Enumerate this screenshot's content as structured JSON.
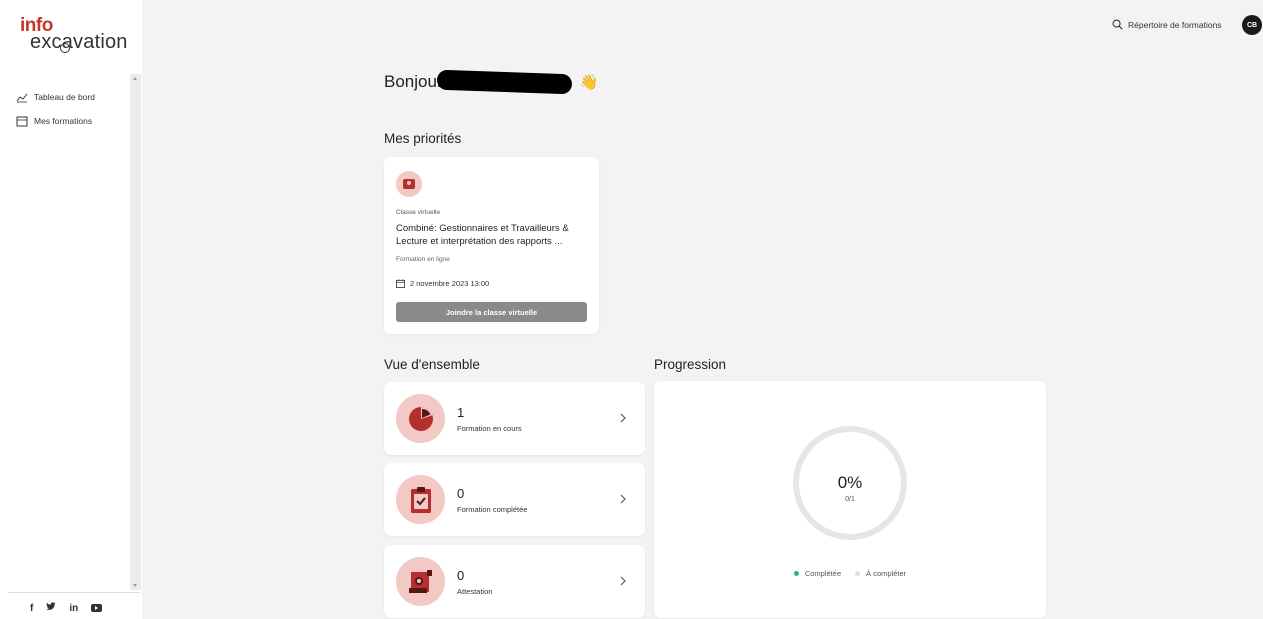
{
  "sidebar": {
    "logo_top": "info",
    "logo_bottom": "excavation",
    "items": [
      {
        "label": "Tableau de bord",
        "icon": "chart-line-icon"
      },
      {
        "label": "Mes formations",
        "icon": "calendar-icon"
      }
    ],
    "social": [
      "f",
      "𝕪",
      "in",
      "youtube"
    ]
  },
  "header": {
    "search_label": "Répertoire de formations",
    "avatar_initials": "CB"
  },
  "greeting": {
    "text": "Bonjour",
    "emoji": "👋"
  },
  "priorities": {
    "title": "Mes priorités",
    "card": {
      "type": "Classe virtuelle",
      "name": "Combiné: Gestionnaires et Travailleurs & Lecture et interprétation des rapports ...",
      "mode": "Formation en ligne",
      "date": "2 novembre 2023 13:00",
      "button_label": "Joindre la classe virtuelle"
    }
  },
  "overview": {
    "title": "Vue d'ensemble",
    "stats": [
      {
        "value": "1",
        "label": "Formation en cours",
        "icon": "pie-icon"
      },
      {
        "value": "0",
        "label": "Formation complétée",
        "icon": "clipboard-check-icon"
      },
      {
        "value": "0",
        "label": "Attestation",
        "icon": "certificate-icon"
      }
    ]
  },
  "progression": {
    "title": "Progression",
    "percent": "0%",
    "fraction": "0/1",
    "legend": [
      {
        "label": "Complétée",
        "color": "#2bb673"
      },
      {
        "label": "À compléter",
        "color": "#e0e0e0"
      }
    ]
  },
  "colors": {
    "accent": "#b3302f",
    "accent_light": "#f3c9c6",
    "button_disabled": "#8a8a8a"
  }
}
